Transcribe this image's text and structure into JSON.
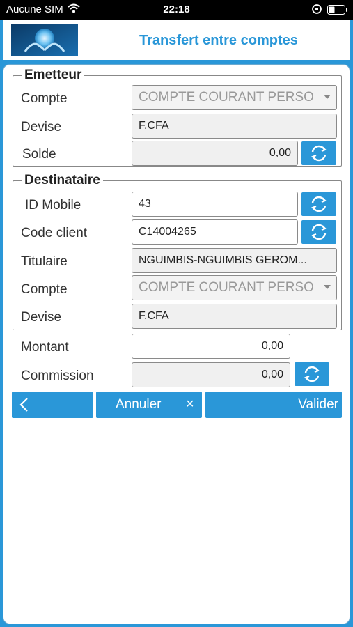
{
  "status_bar": {
    "carrier": "Aucune SIM",
    "time": "22:18"
  },
  "header": {
    "title": "Transfert entre comptes"
  },
  "emetteur": {
    "legend": "Emetteur",
    "compte_label": "Compte",
    "compte_value": "COMPTE COURANT PERSO",
    "devise_label": "Devise",
    "devise_value": "F.CFA",
    "solde_label": "Solde",
    "solde_value": "0,00"
  },
  "destinataire": {
    "legend": "Destinataire",
    "id_mobile_label": "ID Mobile",
    "id_mobile_value": "43",
    "code_client_label": "Code client",
    "code_client_value": "C14004265",
    "titulaire_label": "Titulaire",
    "titulaire_value": "NGUIMBIS-NGUIMBIS  GEROM...",
    "compte_label": "Compte",
    "compte_value": "COMPTE COURANT PERSO",
    "devise_label": "Devise",
    "devise_value": "F.CFA"
  },
  "montant": {
    "label": "Montant",
    "value": "0,00"
  },
  "commission": {
    "label": "Commission",
    "value": "0,00"
  },
  "actions": {
    "cancel": "Annuler",
    "cancel_icon": "×",
    "validate": "Valider"
  },
  "colors": {
    "accent": "#2a97d8",
    "field_border": "#8a8a8a"
  }
}
